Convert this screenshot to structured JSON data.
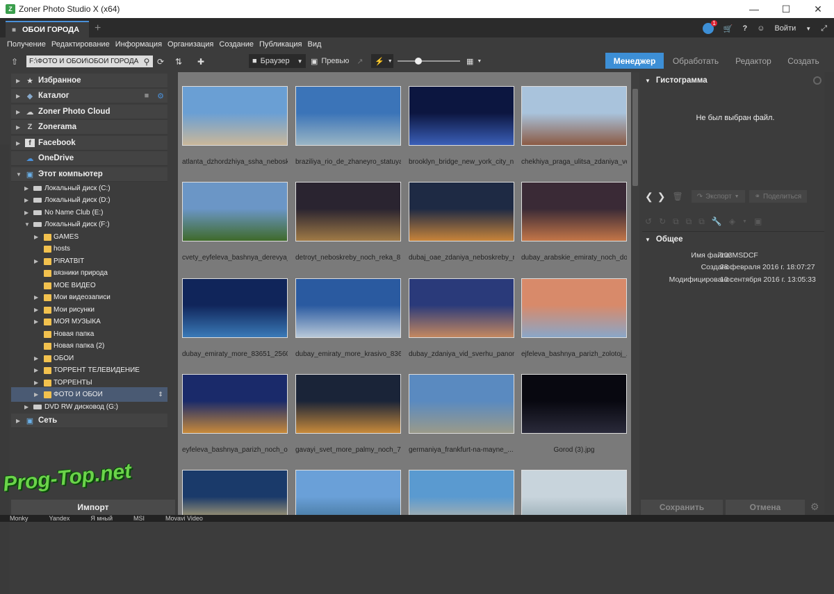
{
  "window": {
    "title": "Zoner Photo Studio X (x64)",
    "icon_letter": "Z"
  },
  "tab": {
    "label": "ОБОИ ГОРОДА"
  },
  "topright": {
    "notif_count": "1",
    "login_label": "Войти"
  },
  "menu": [
    "Получение",
    "Редактирование",
    "Информация",
    "Организация",
    "Создание",
    "Публикация",
    "Вид"
  ],
  "toolbar": {
    "path": "F:\\ФОТО И ОБОИ\\ОБОИ ГОРОДА",
    "browser_label": "Браузер",
    "preview_label": "Превью",
    "modes": [
      "Менеджер",
      "Обработать",
      "Редактор",
      "Создать"
    ]
  },
  "sidebar": {
    "top_items": [
      "Избранное",
      "Каталог",
      "Zoner Photo Cloud",
      "Zonerama",
      "Facebook",
      "OneDrive",
      "Этот компьютер"
    ],
    "drives": [
      "Локальный диск (C:)",
      "Локальный диск (D:)",
      "No Name Club (E:)",
      "Локальный диск (F:)"
    ],
    "folders": [
      "GAMES",
      "hosts",
      "PIRATBIT",
      "вязники природа",
      "МОЕ ВИДЕО",
      "Мои видеозаписи",
      "Мои рисунки",
      "МОЯ МУЗЫКА",
      "Новая папка",
      "Новая папка (2)",
      "ОБОИ",
      "ТОРРЕНТ ТЕЛЕВИДЕНИЕ",
      "ТОРРЕНТЫ",
      "ФОТО И ОБОИ"
    ],
    "dvd": "DVD RW дисковод (G:)",
    "network": "Сеть",
    "import_label": "Импорт"
  },
  "thumbnails": [
    {
      "caption": "atlanta_dzhordzhiya_ssha_nebosk...",
      "c1": "#6a9fd4",
      "c2": "#c9b79a"
    },
    {
      "caption": "braziliya_rio_de_zhaneyro_statuya...",
      "c1": "#3b74b8",
      "c2": "#9ab5c4"
    },
    {
      "caption": "brooklyn_bridge_new_york_city_n...",
      "c1": "#0c1640",
      "c2": "#3a5fb8"
    },
    {
      "caption": "chekhiya_praga_ulitsa_zdaniya_ve...",
      "c1": "#a9c3dc",
      "c2": "#8b5a44"
    },
    {
      "caption": "cvety_eyfeleva_bashnya_derevya_...",
      "c1": "#6b96c6",
      "c2": "#3f6a2a"
    },
    {
      "caption": "detroyt_neboskreby_noch_reka_8...",
      "c1": "#2a2430",
      "c2": "#a07a46"
    },
    {
      "caption": "dubaj_oae_zdaniya_neboskreby_n...",
      "c1": "#1e2a44",
      "c2": "#c8843a"
    },
    {
      "caption": "dubay_arabskie_emiraty_noch_do...",
      "c1": "#3a2a36",
      "c2": "#c47648"
    },
    {
      "caption": "dubay_emiraty_more_83651_2560...",
      "c1": "#10255a",
      "c2": "#3a7ab8"
    },
    {
      "caption": "dubay_emiraty_more_krasivo_836...",
      "c1": "#2a5aa0",
      "c2": "#b8c8d8"
    },
    {
      "caption": "dubay_zdaniya_vid_sverhu_panor...",
      "c1": "#2a3a7a",
      "c2": "#c48860"
    },
    {
      "caption": "ejfeleva_bashnya_parizh_zolotoj_...",
      "c1": "#d88a6a",
      "c2": "#8aa6c8"
    },
    {
      "caption": "eyfeleva_bashnya_parizh_noch_o...",
      "c1": "#1a2a6a",
      "c2": "#c88a3a"
    },
    {
      "caption": "gavayi_svet_more_palmy_noch_7...",
      "c1": "#1a2438",
      "c2": "#c88a3a"
    },
    {
      "caption": "germaniya_frankfurt-na-mayne_...",
      "c1": "#5a8ac0",
      "c2": "#9a9a8a"
    },
    {
      "caption": "Gorod  (3).jpg",
      "c1": "#080810",
      "c2": "#2a2a3a"
    },
    {
      "caption": "",
      "c1": "#1a3a6a",
      "c2": "#e8c87a"
    },
    {
      "caption": "",
      "c1": "#6aa0d8",
      "c2": "#3a6a8a"
    },
    {
      "caption": "",
      "c1": "#5a9ad0",
      "c2": "#c8b8a0"
    },
    {
      "caption": "",
      "c1": "#c8d4dc",
      "c2": "#8aa0a8"
    }
  ],
  "right_panel": {
    "histogram_title": "Гистограмма",
    "no_file": "Не был выбран файл.",
    "export_label": "Экспорт",
    "share_label": "Поделиться",
    "general_title": "Общее",
    "fields": [
      {
        "key": "Имя файла:",
        "value": "103MSDCF"
      },
      {
        "key": "Создано:",
        "value": "28 февраля 2016 г. 18:07:27"
      },
      {
        "key": "Модифицировано:",
        "value": "10 сентября 2016 г. 13:05:33"
      }
    ],
    "save_label": "Сохранить",
    "cancel_label": "Отмена"
  },
  "watermark": "Prog-Top.net",
  "taskbar": [
    "Monky",
    "Yandex",
    "Я мный",
    "MSI",
    "Movavi Video"
  ],
  "colors": {
    "accent": "#3d8fd6",
    "folder": "#f2c14e",
    "watermark": "#6bd34a"
  }
}
